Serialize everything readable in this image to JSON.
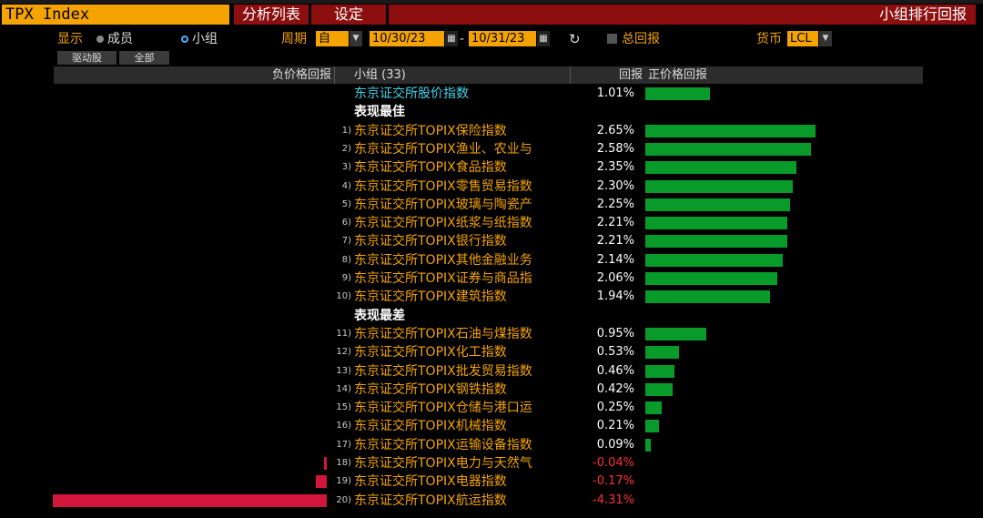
{
  "header": {
    "ticker": "TPX Index",
    "tab_analysis": "分析列表",
    "tab_settings": "设定",
    "title": "小组排行回报"
  },
  "options": {
    "display_label": "显示",
    "opt_members": "成员",
    "opt_group": "小组",
    "period_label": "周期",
    "period_value": "自",
    "date_from": "10/30/23",
    "date_sep": "-",
    "date_to": "10/31/23",
    "total_return_label": "总回报",
    "currency_label": "货币",
    "currency_value": "LCL"
  },
  "subtabs": [
    "驱动股",
    "全部"
  ],
  "table_headers": {
    "neg_return": "负价格回报",
    "group": "小组 (33)",
    "return": "回报",
    "pos_return": "正价格回报"
  },
  "benchmark": {
    "name": "东京证交所股价指数",
    "return": "1.01%",
    "value": 1.01
  },
  "section_best": "表现最佳",
  "section_worst": "表现最差",
  "best": [
    {
      "rank": "1)",
      "name": "东京证交所TOPIX保险指数",
      "return": "2.65%",
      "value": 2.65
    },
    {
      "rank": "2)",
      "name": "东京证交所TOPIX渔业、农业与",
      "return": "2.58%",
      "value": 2.58
    },
    {
      "rank": "3)",
      "name": "东京证交所TOPIX食品指数",
      "return": "2.35%",
      "value": 2.35
    },
    {
      "rank": "4)",
      "name": "东京证交所TOPIX零售贸易指数",
      "return": "2.30%",
      "value": 2.3
    },
    {
      "rank": "5)",
      "name": "东京证交所TOPIX玻璃与陶瓷产",
      "return": "2.25%",
      "value": 2.25
    },
    {
      "rank": "6)",
      "name": "东京证交所TOPIX纸浆与纸指数",
      "return": "2.21%",
      "value": 2.21
    },
    {
      "rank": "7)",
      "name": "东京证交所TOPIX银行指数",
      "return": "2.21%",
      "value": 2.21
    },
    {
      "rank": "8)",
      "name": "东京证交所TOPIX其他金融业务",
      "return": "2.14%",
      "value": 2.14
    },
    {
      "rank": "9)",
      "name": "东京证交所TOPIX证券与商品指",
      "return": "2.06%",
      "value": 2.06
    },
    {
      "rank": "10)",
      "name": "东京证交所TOPIX建筑指数",
      "return": "1.94%",
      "value": 1.94
    }
  ],
  "worst": [
    {
      "rank": "11)",
      "name": "东京证交所TOPIX石油与煤指数",
      "return": "0.95%",
      "value": 0.95
    },
    {
      "rank": "12)",
      "name": "东京证交所TOPIX化工指数",
      "return": "0.53%",
      "value": 0.53
    },
    {
      "rank": "13)",
      "name": "东京证交所TOPIX批发贸易指数",
      "return": "0.46%",
      "value": 0.46
    },
    {
      "rank": "14)",
      "name": "东京证交所TOPIX钢铁指数",
      "return": "0.42%",
      "value": 0.42
    },
    {
      "rank": "15)",
      "name": "东京证交所TOPIX仓储与港口运",
      "return": "0.25%",
      "value": 0.25
    },
    {
      "rank": "16)",
      "name": "东京证交所TOPIX机械指数",
      "return": "0.21%",
      "value": 0.21
    },
    {
      "rank": "17)",
      "name": "东京证交所TOPIX运输设备指数",
      "return": "0.09%",
      "value": 0.09
    },
    {
      "rank": "18)",
      "name": "东京证交所TOPIX电力与天然气",
      "return": "-0.04%",
      "value": -0.04
    },
    {
      "rank": "19)",
      "name": "东京证交所TOPIX电器指数",
      "return": "-0.17%",
      "value": -0.17
    },
    {
      "rank": "20)",
      "name": "东京证交所TOPIX航运指数",
      "return": "-4.31%",
      "value": -4.31
    }
  ],
  "colors": {
    "accent": "#f4a300",
    "header_red": "#8c0e0e",
    "positive_bar": "#089b2a",
    "negative_bar": "#d0163b",
    "negative_text": "#ff3030",
    "benchmark_text": "#3fd4e8"
  }
}
